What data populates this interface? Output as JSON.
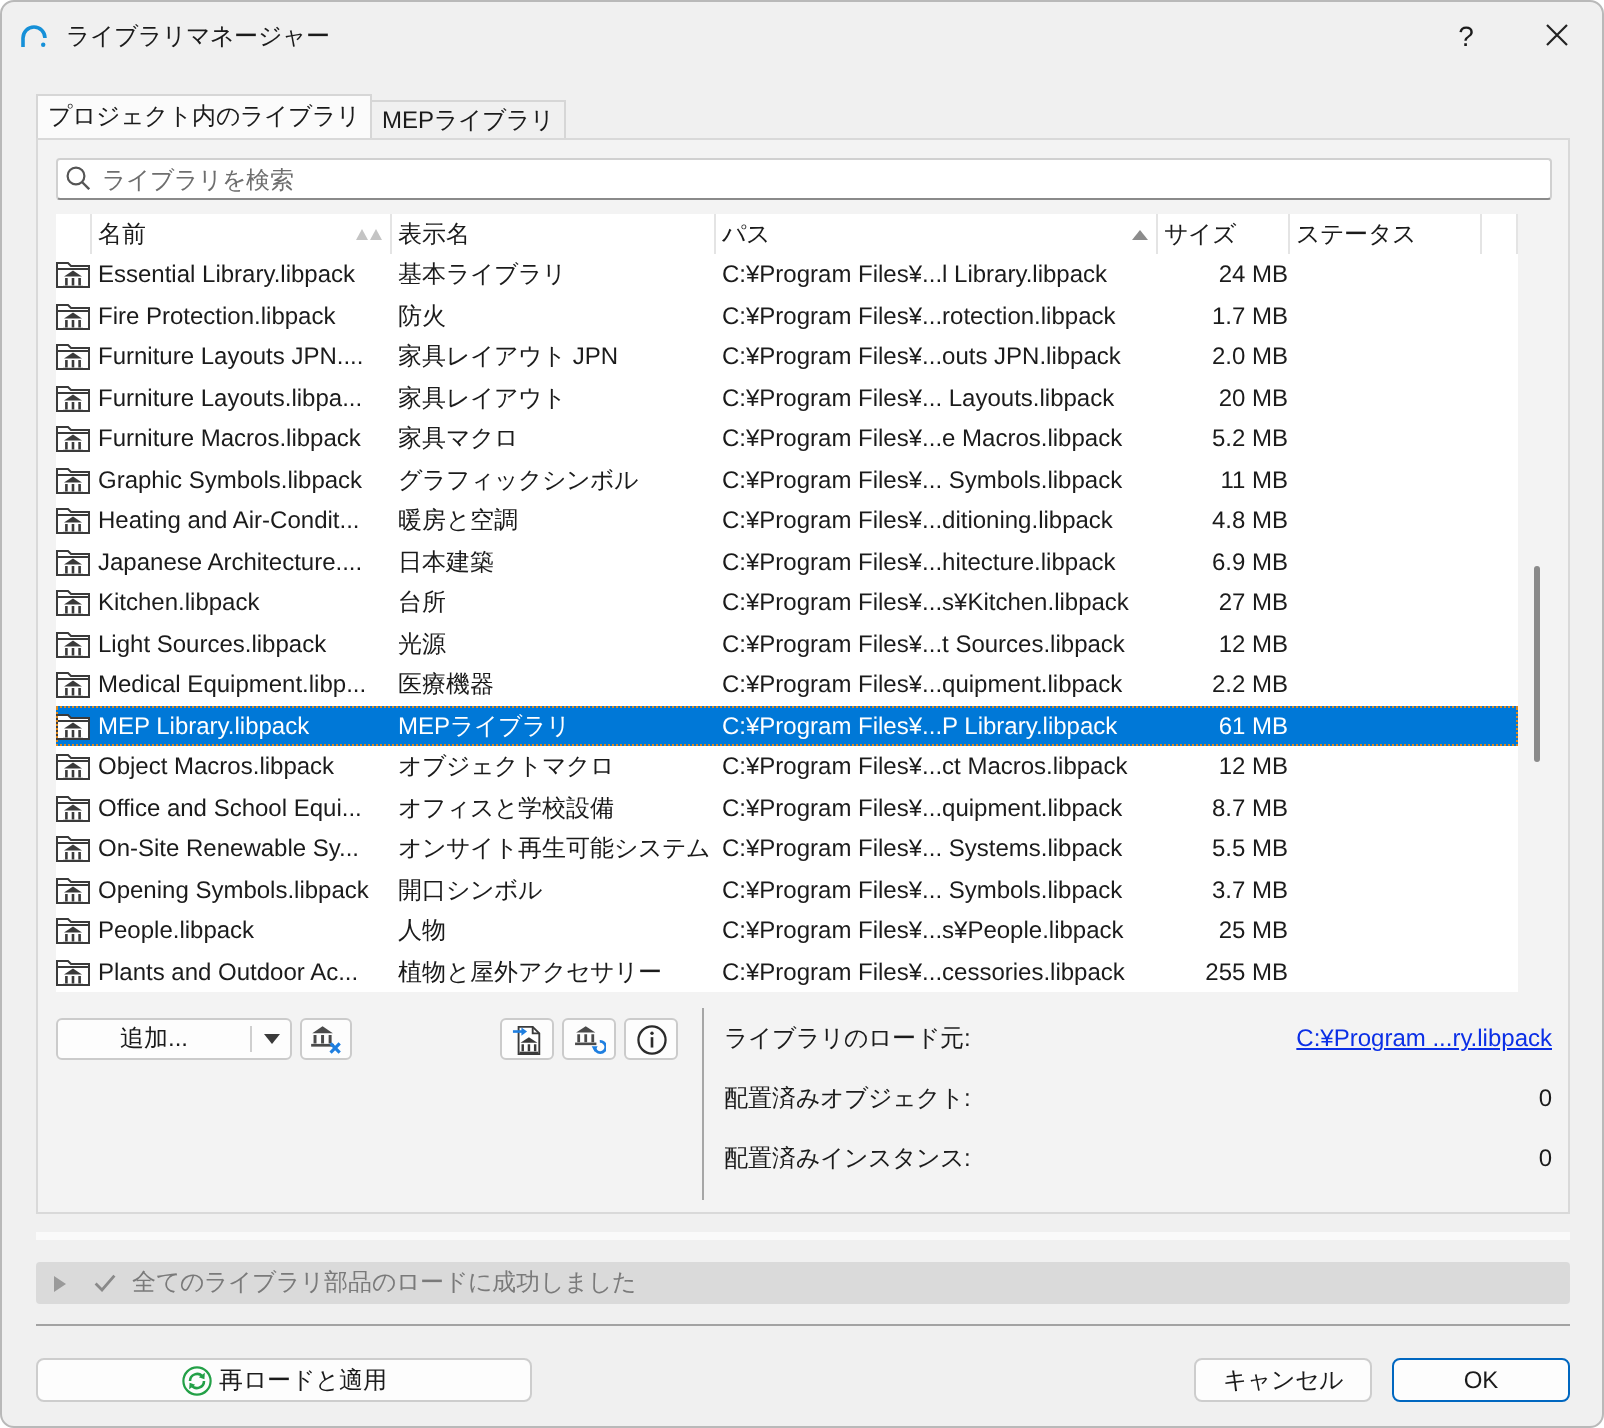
{
  "window": {
    "title": "ライブラリマネージャー",
    "help": "?"
  },
  "tabs": [
    {
      "label": "プロジェクト内のライブラリ",
      "selected": true
    },
    {
      "label": "MEPライブラリ",
      "selected": false
    }
  ],
  "search": {
    "placeholder": "ライブラリを検索"
  },
  "table": {
    "columns": [
      {
        "label": "名前",
        "sorted": true,
        "primary": false
      },
      {
        "label": "表示名",
        "sorted": false
      },
      {
        "label": "パス",
        "sorted": true,
        "primary": true
      },
      {
        "label": "サイズ",
        "sorted": false
      },
      {
        "label": "ステータス",
        "sorted": false
      }
    ],
    "rows": [
      {
        "name": "Essential Library.libpack",
        "display_name": "基本ライブラリ",
        "path": "C:¥Program Files¥...l Library.libpack",
        "size": "24 MB",
        "selected": false
      },
      {
        "name": "Fire Protection.libpack",
        "display_name": "防火",
        "path": "C:¥Program Files¥...rotection.libpack",
        "size": "1.7 MB",
        "selected": false
      },
      {
        "name": "Furniture Layouts JPN....",
        "display_name": "家具レイアウト JPN",
        "path": "C:¥Program Files¥...outs JPN.libpack",
        "size": "2.0 MB",
        "selected": false
      },
      {
        "name": "Furniture Layouts.libpa...",
        "display_name": "家具レイアウト",
        "path": "C:¥Program Files¥... Layouts.libpack",
        "size": "20 MB",
        "selected": false
      },
      {
        "name": "Furniture Macros.libpack",
        "display_name": "家具マクロ",
        "path": "C:¥Program Files¥...e Macros.libpack",
        "size": "5.2 MB",
        "selected": false
      },
      {
        "name": "Graphic Symbols.libpack",
        "display_name": "グラフィックシンボル",
        "path": "C:¥Program Files¥... Symbols.libpack",
        "size": "11 MB",
        "selected": false
      },
      {
        "name": "Heating and Air-Condit...",
        "display_name": "暖房と空調",
        "path": "C:¥Program Files¥...ditioning.libpack",
        "size": "4.8 MB",
        "selected": false
      },
      {
        "name": "Japanese Architecture....",
        "display_name": "日本建築",
        "path": "C:¥Program Files¥...hitecture.libpack",
        "size": "6.9 MB",
        "selected": false
      },
      {
        "name": "Kitchen.libpack",
        "display_name": "台所",
        "path": "C:¥Program Files¥...s¥Kitchen.libpack",
        "size": "27 MB",
        "selected": false
      },
      {
        "name": "Light Sources.libpack",
        "display_name": "光源",
        "path": "C:¥Program Files¥...t Sources.libpack",
        "size": "12 MB",
        "selected": false
      },
      {
        "name": "Medical Equipment.libp...",
        "display_name": "医療機器",
        "path": "C:¥Program Files¥...quipment.libpack",
        "size": "2.2 MB",
        "selected": false
      },
      {
        "name": "MEP Library.libpack",
        "display_name": "MEPライブラリ",
        "path": "C:¥Program Files¥...P Library.libpack",
        "size": "61 MB",
        "selected": true
      },
      {
        "name": "Object Macros.libpack",
        "display_name": "オブジェクトマクロ",
        "path": "C:¥Program Files¥...ct Macros.libpack",
        "size": "12 MB",
        "selected": false
      },
      {
        "name": "Office and School Equi...",
        "display_name": "オフィスと学校設備",
        "path": "C:¥Program Files¥...quipment.libpack",
        "size": "8.7 MB",
        "selected": false
      },
      {
        "name": "On-Site Renewable Sy...",
        "display_name": "オンサイト再生可能システム",
        "path": "C:¥Program Files¥... Systems.libpack",
        "size": "5.5 MB",
        "selected": false
      },
      {
        "name": "Opening Symbols.libpack",
        "display_name": "開口シンボル",
        "path": "C:¥Program Files¥... Symbols.libpack",
        "size": "3.7 MB",
        "selected": false
      },
      {
        "name": "People.libpack",
        "display_name": "人物",
        "path": "C:¥Program Files¥...s¥People.libpack",
        "size": "25 MB",
        "selected": false
      },
      {
        "name": "Plants and Outdoor Ac...",
        "display_name": "植物と屋外アクセサリー",
        "path": "C:¥Program Files¥...cessories.libpack",
        "size": "255 MB",
        "selected": false
      }
    ]
  },
  "toolbar": {
    "add_label": "追加..."
  },
  "info": [
    {
      "kind": "link",
      "label": "ライブラリのロード元:",
      "value": "C:¥Program ...ry.libpack"
    },
    {
      "kind": "text",
      "label": "配置済みオブジェクト:",
      "value": "0"
    },
    {
      "kind": "text",
      "label": "配置済みインスタンス:",
      "value": "0"
    }
  ],
  "status_bar": {
    "text": "全てのライブラリ部品のロードに成功しました",
    "expanded": false
  },
  "buttons": [
    {
      "kind": "reload",
      "label": "再ロードと適用",
      "default": false
    },
    {
      "kind": "cancel",
      "label": "キャンセル",
      "default": false
    },
    {
      "kind": "confirm",
      "label": "OK",
      "default": true
    }
  ]
}
